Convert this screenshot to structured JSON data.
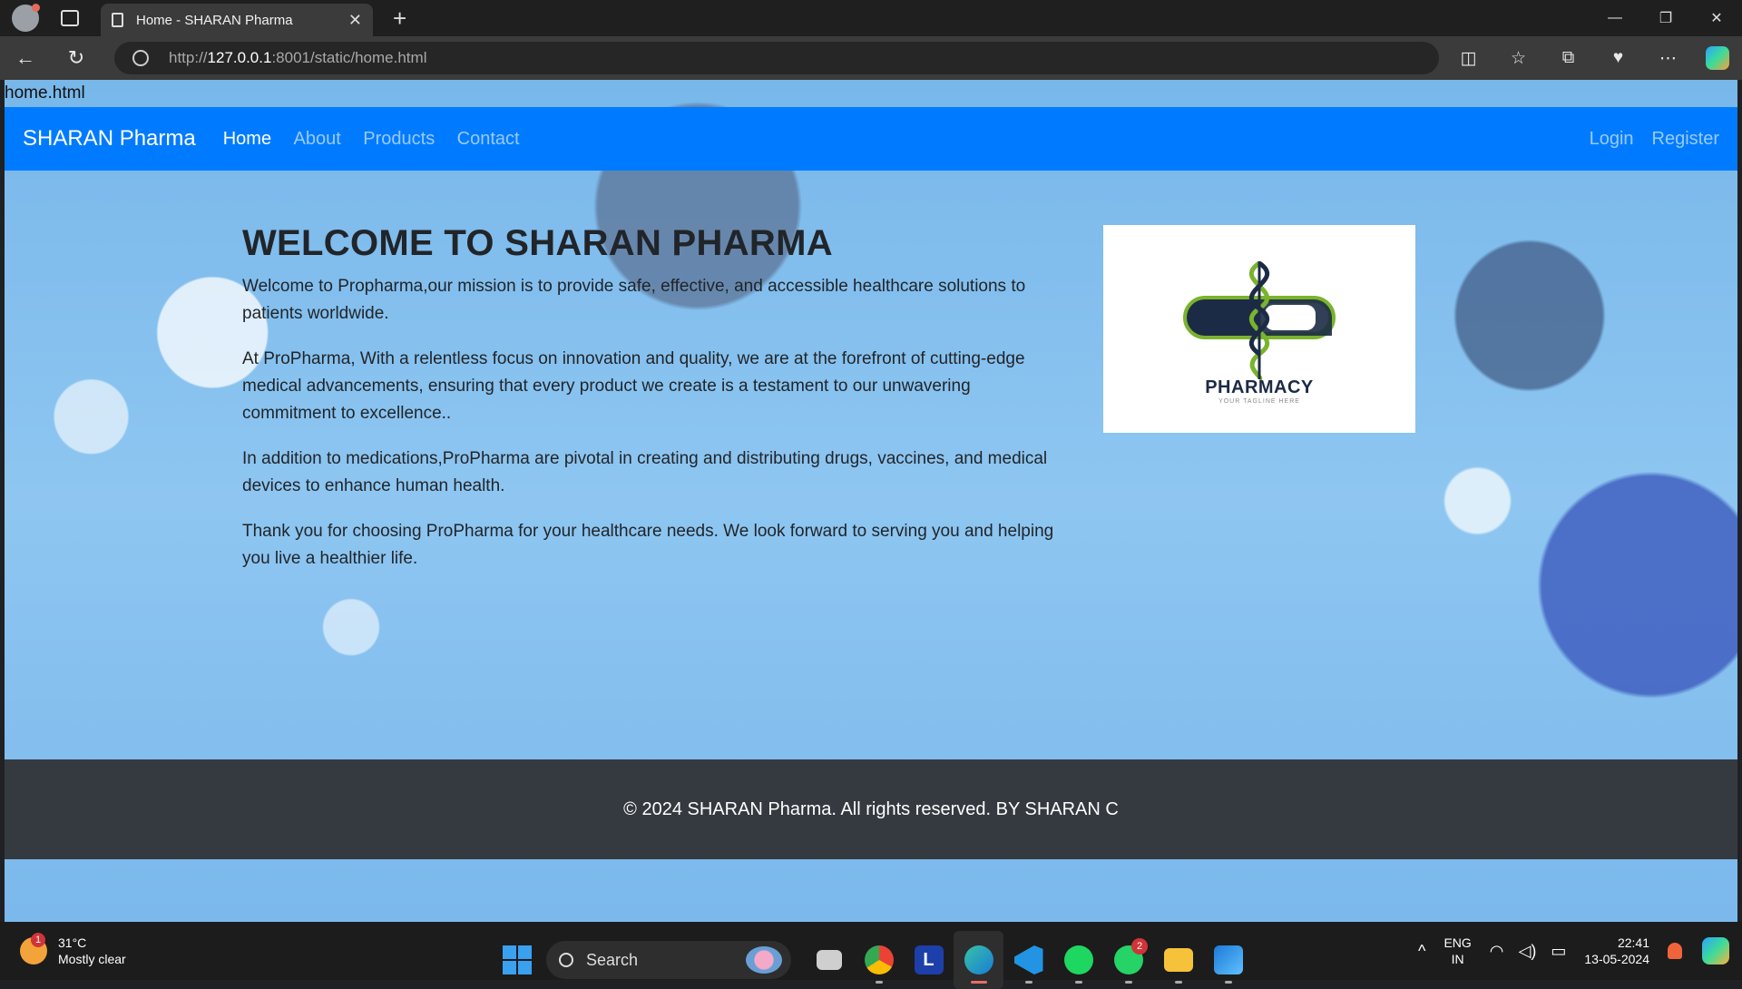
{
  "browser": {
    "tab_title": "Home - SHARAN Pharma",
    "url_prefix": "http://",
    "url_host": "127.0.0.1",
    "url_rest": ":8001/static/home.html"
  },
  "page": {
    "filename_label": "home.html",
    "navbar": {
      "brand": "SHARAN Pharma",
      "links": [
        "Home",
        "About",
        "Products",
        "Contact"
      ],
      "right_links": [
        "Login",
        "Register"
      ]
    },
    "heading": "WELCOME TO SHARAN PHARMA",
    "paragraphs": [
      "Welcome to Propharma,our mission is to provide safe, effective, and accessible healthcare solutions to patients worldwide.",
      "At ProPharma, With a relentless focus on innovation and quality, we are at the forefront of cutting-edge medical advancements, ensuring that every product we create is a testament to our unwavering commitment to excellence..",
      "In addition to medications,ProPharma are pivotal in creating and distributing drugs, vaccines, and medical devices to enhance human health.",
      "Thank you for choosing ProPharma for your healthcare needs. We look forward to serving you and helping you live a healthier life."
    ],
    "logo": {
      "title": "PHARMACY",
      "tagline": "YOUR TAGLINE HERE"
    },
    "footer": "© 2024 SHARAN Pharma. All rights reserved. BY SHARAN C"
  },
  "taskbar": {
    "weather_temp": "31°C",
    "weather_desc": "Mostly clear",
    "weather_badge": "1",
    "search_label": "Search",
    "whatsapp_badge": "2",
    "lang_1": "ENG",
    "lang_2": "IN",
    "time": "22:41",
    "date": "13-05-2024"
  },
  "colors": {
    "navbar": "#007bff",
    "footer": "#343a40",
    "logo_green": "#7ab32e",
    "logo_navy": "#1c2b45"
  }
}
